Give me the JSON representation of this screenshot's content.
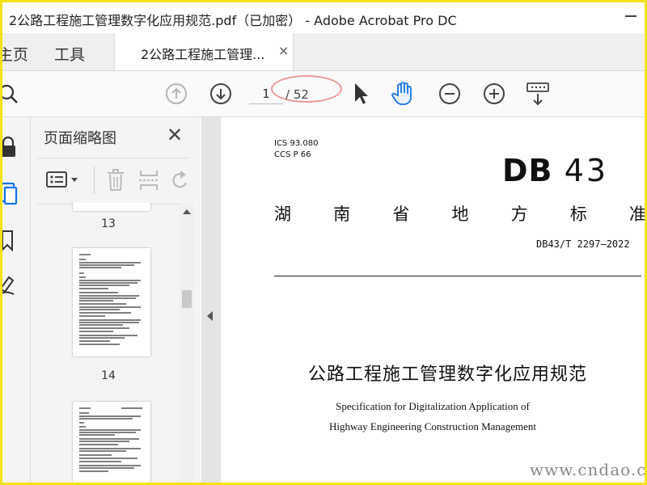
{
  "window": {
    "title": "2公路工程施工管理数字化应用规范.pdf（已加密） - Adobe Acrobat Pro DC"
  },
  "tabs": {
    "home_label": "主页",
    "tools_label": "工具",
    "document_tab_label": "2公路工程施工管理...",
    "close_glyph": "×"
  },
  "toolbar": {
    "current_page": "1",
    "total_pages": "/ 52"
  },
  "thumbnail_panel": {
    "title": "页面缩略图",
    "close_glyph": "✕",
    "thumbnails": [
      {
        "page_label": "13"
      },
      {
        "page_label": "14"
      }
    ]
  },
  "document": {
    "ics_line": "ICS 93.080",
    "ccs_line": "CCS P 66",
    "db_prefix": "DB",
    "db_number": "43",
    "region_chars": [
      "湖",
      "南",
      "省",
      "地",
      "方",
      "标",
      "准"
    ],
    "standard_number": "DB43/T 2297—2022",
    "title_cn": "公路工程施工管理数字化应用规范",
    "title_en_line1": "Specification for Digitalization Application of",
    "title_en_line2": "Highway Engineering Construction Management"
  },
  "watermark": {
    "text": "www.cndao.com"
  },
  "colors": {
    "accent": "#1473e6",
    "frame_border": "#f5e21b",
    "annotation_oval": "#e87878"
  }
}
